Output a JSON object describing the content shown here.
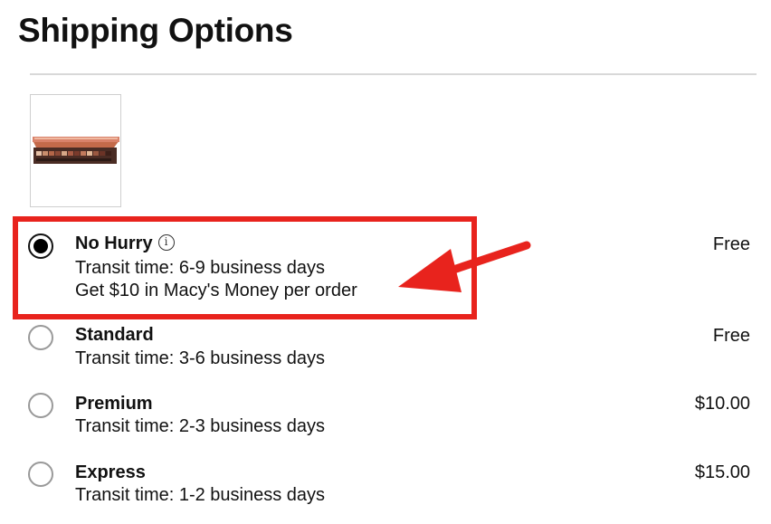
{
  "page_title": "Shipping Options",
  "product": {
    "image_icon": "eyeshadow-palette-image"
  },
  "info_icon_glyph": "i",
  "options": [
    {
      "name": "No Hurry",
      "transit": "Transit time: 6-9 business days",
      "promo": "Get $10 in Macy's Money per order",
      "price": "Free",
      "selected": true
    },
    {
      "name": "Standard",
      "transit": "Transit time: 3-6 business days",
      "price": "Free",
      "selected": false
    },
    {
      "name": "Premium",
      "transit": "Transit time: 2-3 business days",
      "price": "$10.00",
      "selected": false
    },
    {
      "name": "Express",
      "transit": "Transit time: 1-2 business days",
      "price": "$15.00",
      "selected": false
    }
  ],
  "annotation": {
    "color": "#e8231d",
    "type": "arrow-and-box-highlight"
  }
}
